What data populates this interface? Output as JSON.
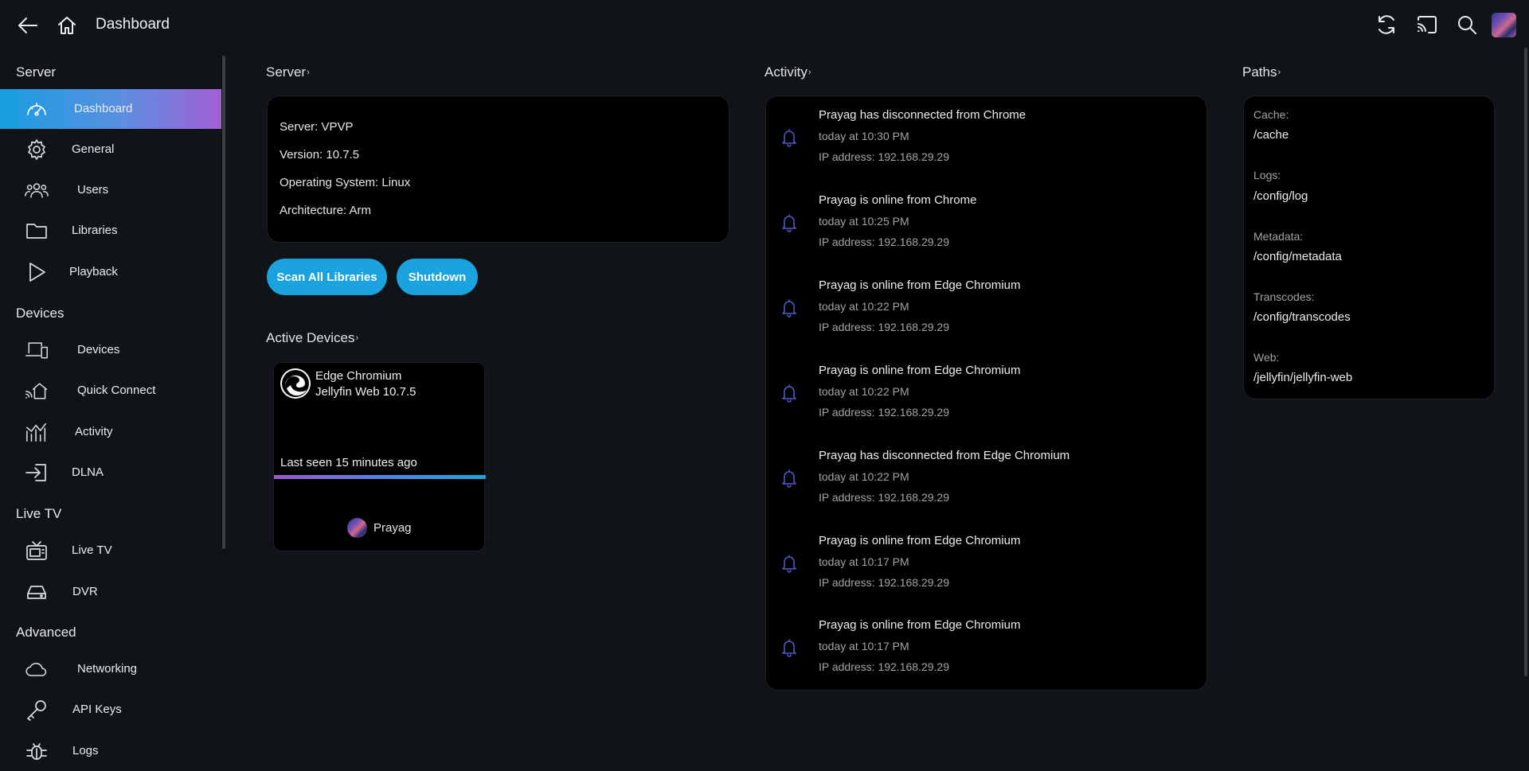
{
  "header": {
    "title": "Dashboard",
    "icons": [
      "back-arrow-icon",
      "home-icon",
      "refresh-icon",
      "cast-icon",
      "search-icon",
      "user-avatar"
    ]
  },
  "sidebar": {
    "sections": [
      {
        "label": "Server"
      },
      {
        "label": "Devices"
      },
      {
        "label": "Live TV"
      },
      {
        "label": "Advanced"
      }
    ],
    "items": [
      {
        "label": "Dashboard",
        "icon": "dashboard-gauge-icon",
        "active": true
      },
      {
        "label": "General",
        "icon": "gear-icon"
      },
      {
        "label": "Users",
        "icon": "users-icon"
      },
      {
        "label": "Libraries",
        "icon": "folder-icon"
      },
      {
        "label": "Playback",
        "icon": "play-icon"
      },
      {
        "label": "Devices",
        "icon": "devices-icon"
      },
      {
        "label": "Quick Connect",
        "icon": "quick-connect-icon"
      },
      {
        "label": "Activity",
        "icon": "activity-chart-icon"
      },
      {
        "label": "DLNA",
        "icon": "dlna-icon"
      },
      {
        "label": "Live TV",
        "icon": "tv-icon"
      },
      {
        "label": "DVR",
        "icon": "dvr-icon"
      },
      {
        "label": "Networking",
        "icon": "cloud-icon"
      },
      {
        "label": "API Keys",
        "icon": "key-icon"
      },
      {
        "label": "Logs",
        "icon": "bug-icon"
      }
    ]
  },
  "server": {
    "heading": "Server",
    "lines": [
      "Server: VPVP",
      "Version: 10.7.5",
      "Operating System: Linux",
      "Architecture: Arm"
    ],
    "scan_button": "Scan All Libraries",
    "shutdown_button": "Shutdown"
  },
  "active_devices": {
    "heading": "Active Devices",
    "device": {
      "name_line1": "Edge Chromium",
      "name_line2": "Jellyfin Web 10.7.5",
      "last_seen": "Last seen 15 minutes ago",
      "user": "Prayag"
    }
  },
  "activity": {
    "heading": "Activity",
    "items": [
      {
        "title": "Prayag has disconnected from Chrome",
        "time": "today at 10:30 PM",
        "ip": "IP address: 192.168.29.29"
      },
      {
        "title": "Prayag is online from Chrome",
        "time": "today at 10:25 PM",
        "ip": "IP address: 192.168.29.29"
      },
      {
        "title": "Prayag is online from Edge Chromium",
        "time": "today at 10:22 PM",
        "ip": "IP address: 192.168.29.29"
      },
      {
        "title": "Prayag is online from Edge Chromium",
        "time": "today at 10:22 PM",
        "ip": "IP address: 192.168.29.29"
      },
      {
        "title": "Prayag has disconnected from Edge Chromium",
        "time": "today at 10:22 PM",
        "ip": "IP address: 192.168.29.29"
      },
      {
        "title": "Prayag is online from Edge Chromium",
        "time": "today at 10:17 PM",
        "ip": "IP address: 192.168.29.29"
      },
      {
        "title": "Prayag is online from Edge Chromium",
        "time": "today at 10:17 PM",
        "ip": "IP address: 192.168.29.29"
      }
    ]
  },
  "paths": {
    "heading": "Paths",
    "entries": [
      {
        "label": "Cache:",
        "value": "/cache"
      },
      {
        "label": "Logs:",
        "value": "/config/log"
      },
      {
        "label": "Metadata:",
        "value": "/config/metadata"
      },
      {
        "label": "Transcodes:",
        "value": "/config/transcodes"
      },
      {
        "label": "Web:",
        "value": "/jellyfin/jellyfin-web"
      }
    ]
  },
  "colors": {
    "background": "#101418",
    "accent": "#1aa3df",
    "active_gradient_end": "#a35fd6",
    "bell": "#4d57c8"
  }
}
